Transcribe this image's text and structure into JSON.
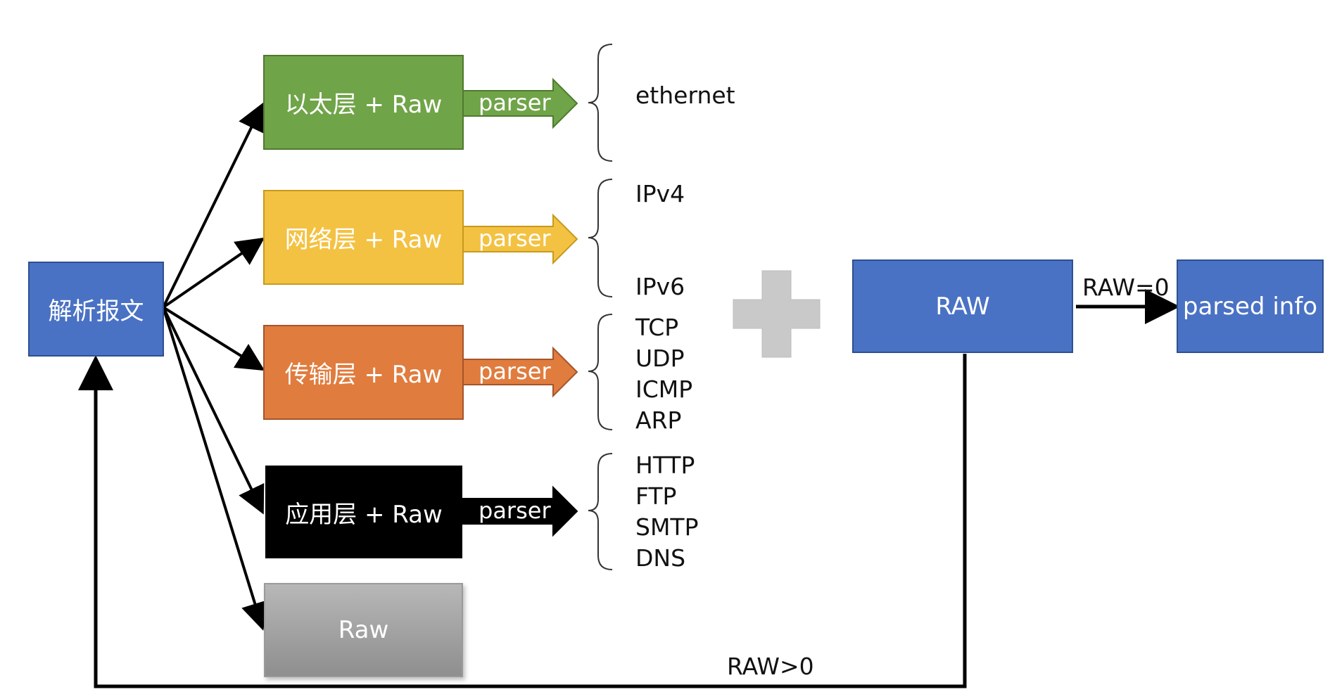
{
  "colors": {
    "ethernet": "#70a448",
    "network": "#f4c242",
    "transport": "#e07c3e",
    "application": "#000000",
    "raw_box": "#a6a6a6",
    "blue": "#4a72c4",
    "plus": "#c9c9c9",
    "line": "#000000"
  },
  "main_box": {
    "label": "解析报文"
  },
  "layers": [
    {
      "label": "以太层 + Raw",
      "parser": "parser",
      "protocols": [
        "ethernet"
      ]
    },
    {
      "label": "网络层 + Raw",
      "parser": "parser",
      "protocols": [
        "IPv4",
        "IPv6"
      ]
    },
    {
      "label": "传输层 + Raw",
      "parser": "parser",
      "protocols": [
        "TCP",
        "UDP",
        "ICMP",
        "ARP"
      ]
    },
    {
      "label": "应用层 + Raw",
      "parser": "parser",
      "protocols": [
        "HTTP",
        "FTP",
        "SMTP",
        "DNS"
      ]
    }
  ],
  "raw_box": {
    "label": "Raw"
  },
  "plus_icon": "plus-icon",
  "raw_node": {
    "label": "RAW"
  },
  "parsed_node": {
    "label": "parsed info"
  },
  "edges": {
    "raw_to_parsed": "RAW=0",
    "raw_loop": "RAW>0"
  }
}
